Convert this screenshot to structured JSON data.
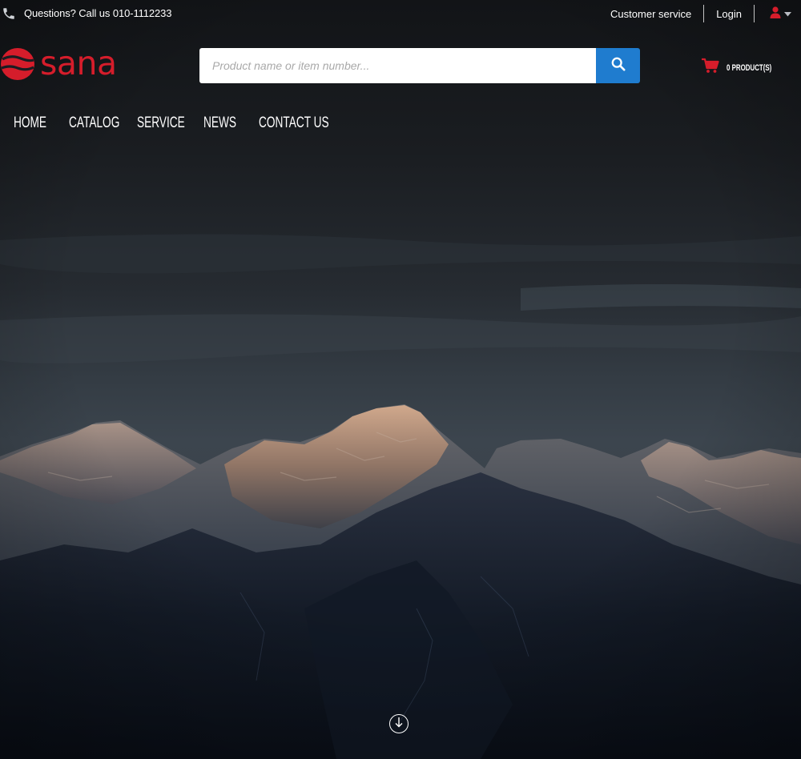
{
  "topbar": {
    "phone_icon": "phone-icon",
    "question_text": "Questions? Call us 010-1112233",
    "customer_service": "Customer service",
    "login": "Login",
    "account_icon": "user-icon"
  },
  "header": {
    "logo_text": "sana",
    "search": {
      "placeholder": "Product name or item number...",
      "value": "",
      "button_icon": "search-icon"
    },
    "cart": {
      "icon": "cart-icon",
      "label": "0 PRODUCT(S)"
    }
  },
  "nav": {
    "items": [
      {
        "label": "HOME"
      },
      {
        "label": "CATALOG"
      },
      {
        "label": "SERVICE"
      },
      {
        "label": "NEWS"
      },
      {
        "label": "CONTACT US"
      }
    ]
  },
  "hero": {
    "scroll_icon": "arrow-down-circle-icon"
  },
  "colors": {
    "brand_red": "#d51d2b",
    "search_button_blue": "#1f7ccf",
    "text_white": "#ffffff",
    "page_dark": "#0c1016"
  }
}
